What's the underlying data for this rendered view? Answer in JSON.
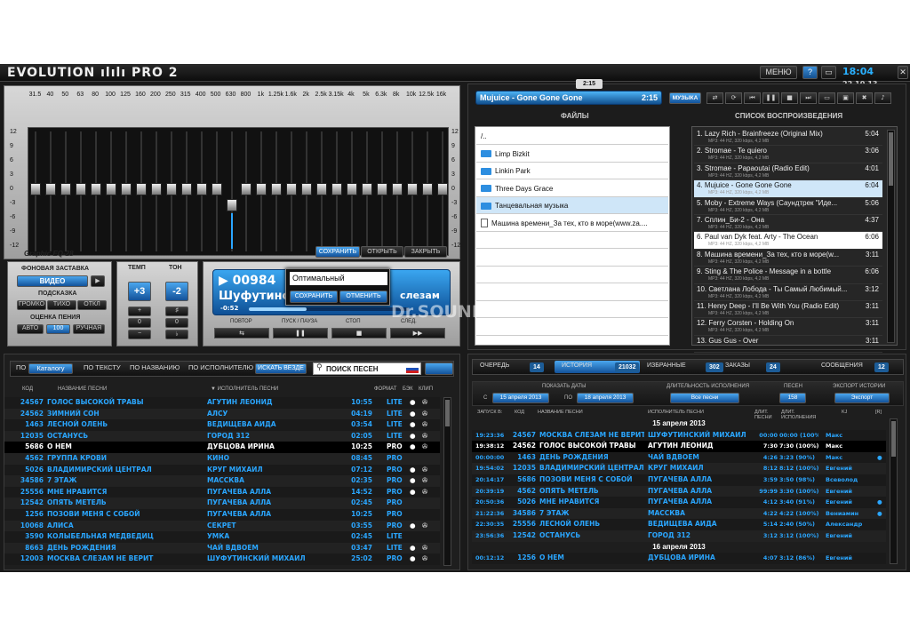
{
  "header": {
    "logo": "EVOLUTION ılılı PRO 2",
    "menu_label": "МЕНЮ",
    "help_label": "?",
    "time": "18:04",
    "date": "22.10.13"
  },
  "equalizer": {
    "freq_labels": [
      "31.5",
      "40",
      "50",
      "63",
      "80",
      "100",
      "125",
      "160",
      "200",
      "250",
      "315",
      "400",
      "500",
      "630",
      "800",
      "1k",
      "1.25k",
      "1.6k",
      "2k",
      "2.5k",
      "3.15k",
      "4k",
      "5k",
      "6.3k",
      "8k",
      "10k",
      "12.5k",
      "16k"
    ],
    "db_labels": [
      "12",
      "9",
      "6",
      "3",
      "0",
      "-3",
      "-6",
      "-9",
      "-12"
    ],
    "name": "Graphic EQ-28",
    "save_label": "СОХРАНИТЬ",
    "open_label": "ОТКРЫТЬ",
    "close_label": "ЗАКРЫТЬ",
    "save_popup": {
      "input_value": "Оптимальный",
      "save_label": "СОХРАНИТЬ",
      "cancel_label": "ОТМЕНИТЬ"
    }
  },
  "background": {
    "title": "ФОНОВАЯ ЗАСТАВКА",
    "mode": "ВИДЕО",
    "hint_title": "ПОДСКАЗКА",
    "hint_options": [
      "ГРОМКО",
      "ТИХО",
      "ОТКЛ"
    ],
    "rating_title": "ОЦЕНКА ПЕНИЯ",
    "rating_auto": "АВТО",
    "rating_value": "100",
    "rating_manual": "РУЧНАЯ"
  },
  "tempo": {
    "title": "ТЕМП",
    "value": "+3"
  },
  "tone": {
    "title": "ТОН",
    "value": "-2"
  },
  "player": {
    "track_number": "00984",
    "artist_short": "Шуфутинск",
    "song_short": "слезам",
    "elapsed": "-0:52",
    "controls": [
      "ПОВТОР",
      "ПУСК / ПАУЗА",
      "СТОП",
      "СЛЕД."
    ],
    "now_playing": "Mujuice - Gone Gone Gone",
    "now_time": "2:15",
    "top_time": "2:15",
    "music_button": "МУЗЫКА",
    "watermark": "Dr.SOUND"
  },
  "files": {
    "title": "ФАЙЛЫ",
    "items": [
      {
        "name": "/..",
        "type": "up"
      },
      {
        "name": "Limp Bizkit",
        "type": "folder"
      },
      {
        "name": "Linkin Park",
        "type": "folder"
      },
      {
        "name": "Three Days Grace",
        "type": "folder"
      },
      {
        "name": "Танцевальная музыка",
        "type": "folder"
      },
      {
        "name": "Машина времени_За тех, кто в море(www.za....",
        "type": "file"
      }
    ]
  },
  "playlist": {
    "title": "СПИСОК ВОСПРОИЗВЕДЕНИЯ",
    "items": [
      {
        "title": "1. Lazy Rich - Brainfreeze (Original Mix)",
        "duration": "5:04",
        "meta": "MP3: 44 HZ, 320 kbps, 4,2 MB"
      },
      {
        "title": "2. Stromae - Te quiero",
        "duration": "3:06",
        "meta": "MP3: 44 HZ, 320 kbps, 4,2 MB"
      },
      {
        "title": "3. Stromae - Papaoutai (Radio Edit)",
        "duration": "4:01",
        "meta": "MP3: 44 HZ, 320 kbps, 4,2 MB"
      },
      {
        "title": "4. Mujuice - Gone Gone Gone",
        "duration": "6:04",
        "meta": "MP3: 44 HZ, 320 kbps, 4,2 MB"
      },
      {
        "title": "5. Moby - Extreme Ways (Саундтрек \"Иде...",
        "duration": "5:06",
        "meta": "MP3: 44 HZ, 320 kbps, 4,2 MB"
      },
      {
        "title": "7. Сплин_Би-2 - Она",
        "duration": "4:37",
        "meta": "MP3: 44 HZ, 320 kbps, 4,2 MB"
      },
      {
        "title": "6. Paul van Dyk feat. Arty - The Ocean",
        "duration": "6:06",
        "meta": "MP3: 44 HZ, 320 kbps, 4,2 MB"
      },
      {
        "title": "8. Машина времени_За тех, кто в море(w...",
        "duration": "3:11",
        "meta": "MP3: 44 HZ, 320 kbps, 4,2 MB"
      },
      {
        "title": "9. Sting & The Police - Message in a bottle",
        "duration": "6:06",
        "meta": "MP3: 44 HZ, 320 kbps, 4,2 MB"
      },
      {
        "title": "10. Светлана Лобода - Ты Самый Любимый...",
        "duration": "3:12",
        "meta": "MP3: 44 HZ, 320 kbps, 4,2 MB"
      },
      {
        "title": "11. Henry Deep - I'll Be With You (Radio Edit)",
        "duration": "3:11",
        "meta": "MP3: 44 HZ, 320 kbps, 4,2 MB"
      },
      {
        "title": "12. Ferry Corsten - Holding On",
        "duration": "3:11",
        "meta": "MP3: 44 HZ, 320 kbps, 4,2 MB"
      },
      {
        "title": "13. Gus Gus - Over",
        "duration": "3:11",
        "meta": ""
      }
    ]
  },
  "catalog": {
    "tabs": [
      "ПО",
      "Каталогу",
      "ПО ТЕКСТУ",
      "ПО НАЗВАНИЮ",
      "ПО ИСПОЛНИТЕЛЮ",
      "ИСКАТЬ ВЕЗДЕ"
    ],
    "search_placeholder": "ПОИСК ПЕСЕН",
    "columns": [
      "КОД",
      "НАЗВАНИЕ ПЕСНИ",
      "▼ ИСПОЛНИТЕЛЬ ПЕСНИ",
      "ФОРМАТ",
      "БЭК",
      "КЛИП"
    ],
    "rows": [
      {
        "code": "24567",
        "title": "ГОЛОС ВЫСОКОЙ ТРАВЫ",
        "artist": "АГУТИН ЛЕОНИД",
        "time": "10:55",
        "format": "LITE",
        "bk": "●",
        "clip": "✇"
      },
      {
        "code": "24562",
        "title": "ЗИМНИЙ СОН",
        "artist": "АЛСУ",
        "time": "04:19",
        "format": "LITE",
        "bk": "●",
        "clip": "✇"
      },
      {
        "code": "1463",
        "title": "ЛЕСНОЙ ОЛЕНЬ",
        "artist": "ВЕДИЩЕВА АИДА",
        "time": "03:54",
        "format": "LITE",
        "bk": "●",
        "clip": "✇"
      },
      {
        "code": "12035",
        "title": "ОСТАНУСЬ",
        "artist": "ГОРОД 312",
        "time": "02:05",
        "format": "LITE",
        "bk": "●",
        "clip": "✇"
      },
      {
        "code": "5686",
        "title": "О НЕМ",
        "artist": "ДУБЦОВА ИРИНА",
        "time": "10:25",
        "format": "PRO",
        "bk": "●",
        "clip": "✇"
      },
      {
        "code": "4562",
        "title": "ГРУППА КРОВИ",
        "artist": "КИНО",
        "time": "08:45",
        "format": "PRO",
        "bk": "",
        "clip": ""
      },
      {
        "code": "5026",
        "title": "ВЛАДИМИРСКИЙ ЦЕНТРАЛ",
        "artist": "КРУГ МИХАИЛ",
        "time": "07:12",
        "format": "PRO",
        "bk": "●",
        "clip": "✇"
      },
      {
        "code": "34586",
        "title": "7 ЭТАЖ",
        "artist": "МАССКВА",
        "time": "02:35",
        "format": "PRO",
        "bk": "●",
        "clip": "✇"
      },
      {
        "code": "25556",
        "title": "МНЕ НРАВИТСЯ",
        "artist": "ПУГАЧЕВА АЛЛА",
        "time": "14:52",
        "format": "PRO",
        "bk": "●",
        "clip": "✇"
      },
      {
        "code": "12542",
        "title": "ОПЯТЬ МЕТЕЛЬ",
        "artist": "ПУГАЧЕВА АЛЛА",
        "time": "02:45",
        "format": "PRO",
        "bk": "",
        "clip": ""
      },
      {
        "code": "1256",
        "title": "ПОЗОВИ МЕНЯ С СОБОЙ",
        "artist": "ПУГАЧЕВА АЛЛА",
        "time": "10:25",
        "format": "PRO",
        "bk": "",
        "clip": ""
      },
      {
        "code": "10068",
        "title": "АЛИСА",
        "artist": "СЕКРЕТ",
        "time": "03:55",
        "format": "PRO",
        "bk": "●",
        "clip": "✇"
      },
      {
        "code": "3590",
        "title": "КОЛЫБЕЛЬНАЯ МЕДВЕДИЦ",
        "artist": "УМКА",
        "time": "02:45",
        "format": "LITE",
        "bk": "",
        "clip": ""
      },
      {
        "code": "8663",
        "title": "ДЕНЬ РОЖДЕНИЯ",
        "artist": "ЧАЙ ВДВОЕМ",
        "time": "03:47",
        "format": "LITE",
        "bk": "●",
        "clip": "✇"
      },
      {
        "code": "12003",
        "title": "МОСКВА СЛЕЗАМ НЕ ВЕРИТ",
        "artist": "ШУФУТИНСКИЙ МИХАИЛ",
        "time": "25:02",
        "format": "PRO",
        "bk": "●",
        "clip": "✇"
      }
    ]
  },
  "history": {
    "tabs": [
      {
        "label": "ОЧЕРЕДЬ",
        "count": "14"
      },
      {
        "label": "ИСТОРИЯ",
        "count": "21032"
      },
      {
        "label": "ИЗБРАННЫЕ",
        "count": "302"
      },
      {
        "label": "ЗАКАЗЫ",
        "count": "24"
      },
      {
        "label": "СООБЩЕНИЯ",
        "count": "12"
      }
    ],
    "show_dates_label": "ПОКАЗАТЬ ДАТЫ",
    "from_label": "С",
    "from_date": "15 апреля 2013",
    "to_label": "ПО",
    "to_date": "18 апреля 2013",
    "duration_label": "ДЛИТЕЛЬНОСТЬ ИСПОЛНЕНИЯ",
    "duration_value": "Все песни",
    "songs_label": "ПЕСЕН",
    "songs_count": "158",
    "export_label": "ЭКСПОРТ ИСТОРИИ",
    "export_button": "Экспорт",
    "columns": [
      "ЗАПУСК В:",
      "КОД",
      "НАЗВАНИЕ ПЕСНИ",
      "ИСПОЛНИТЕЛЬ ПЕСНИ",
      "ДЛИТ. ПЕСНИ",
      "ДЛИТ. ИСПОЛНЕНИЯ",
      "KJ",
      "[R]"
    ],
    "groups": [
      {
        "date": "15 апреля 2013",
        "rows": [
          {
            "start": "19:23:36",
            "code": "24567",
            "title": "МОСКВА СЛЕЗАМ НЕ ВЕРИТ",
            "artist": "ШУФУТИНСКИЙ МИХАИЛ",
            "len": "00:00",
            "played": "00:00 (100%)",
            "kj": "Макс",
            "r": ""
          },
          {
            "start": "19:38:12",
            "code": "24562",
            "title": "ГОЛОС ВЫСОКОЙ ТРАВЫ",
            "artist": "АГУТИН ЛЕОНИД",
            "len": "7:30",
            "played": "7:30 (100%)",
            "kj": "Макс",
            "r": ""
          },
          {
            "start": "00:00:00",
            "code": "1463",
            "title": "ДЕНЬ РОЖДЕНИЯ",
            "artist": "ЧАЙ ВДВОЕМ",
            "len": "4:26",
            "played": "3:23 (90%)",
            "kj": "Макс",
            "r": "●"
          },
          {
            "start": "19:54:02",
            "code": "12035",
            "title": "ВЛАДИМИРСКИЙ ЦЕНТРАЛ",
            "artist": "КРУГ МИХАИЛ",
            "len": "8:12",
            "played": "8:12 (100%)",
            "kj": "Евгений",
            "r": ""
          },
          {
            "start": "20:14:17",
            "code": "5686",
            "title": "ПОЗОВИ МЕНЯ С СОБОЙ",
            "artist": "ПУГАЧЕВА АЛЛА",
            "len": "3:59",
            "played": "3:50 (98%)",
            "kj": "Всеволод",
            "r": ""
          },
          {
            "start": "20:39:19",
            "code": "4562",
            "title": "ОПЯТЬ МЕТЕЛЬ",
            "artist": "ПУГАЧЕВА АЛЛА",
            "len": "99:99",
            "played": "3:30 (100%)",
            "kj": "Евгений",
            "r": ""
          },
          {
            "start": "20:50:36",
            "code": "5026",
            "title": "МНЕ НРАВИТСЯ",
            "artist": "ПУГАЧЕВА АЛЛА",
            "len": "4:12",
            "played": "3:40 (91%)",
            "kj": "Евгений",
            "r": "●"
          },
          {
            "start": "21:22:36",
            "code": "34586",
            "title": "7 ЭТАЖ",
            "artist": "МАССКВА",
            "len": "4:22",
            "played": "4:22 (100%)",
            "kj": "Вениамин",
            "r": "●"
          },
          {
            "start": "22:30:35",
            "code": "25556",
            "title": "ЛЕСНОЙ ОЛЕНЬ",
            "artist": "ВЕДИЩЕВА АИДА",
            "len": "5:14",
            "played": "2:40 (50%)",
            "kj": "Александр",
            "r": ""
          },
          {
            "start": "23:56:36",
            "code": "12542",
            "title": "ОСТАНУСЬ",
            "artist": "ГОРОД 312",
            "len": "3:12",
            "played": "3:12 (100%)",
            "kj": "Евгений",
            "r": ""
          }
        ]
      },
      {
        "date": "16 апреля 2013",
        "rows": [
          {
            "start": "00:12:12",
            "code": "1256",
            "title": "О НЕМ",
            "artist": "ДУБЦОВА ИРИНА",
            "len": "4:07",
            "played": "3:12 (86%)",
            "kj": "Евгений",
            "r": ""
          }
        ]
      }
    ]
  }
}
